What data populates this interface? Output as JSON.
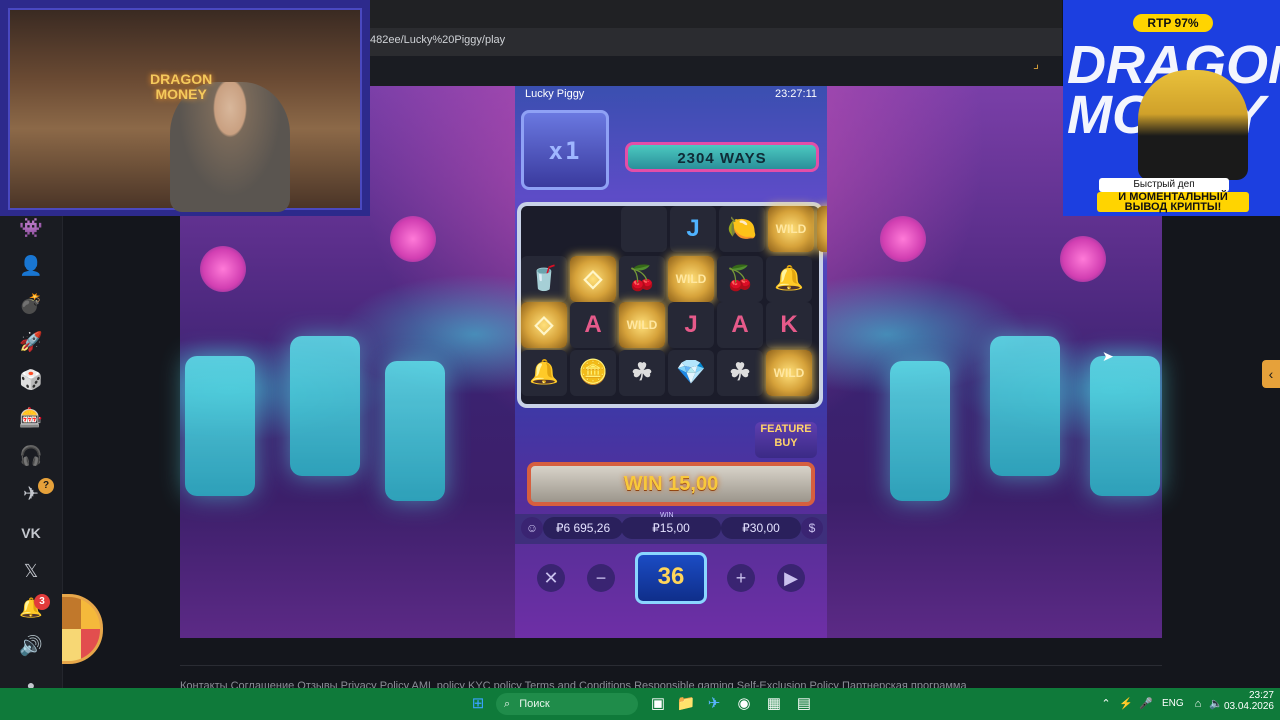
{
  "browser": {
    "url": "482ee/Lucky%20Piggy/play"
  },
  "webcam": {
    "brand_line1": "DRAGON",
    "brand_line2": "MONEY"
  },
  "ad": {
    "rtp": "RTP 97%",
    "brand": "DRAGON MONEY",
    "line1": "Быстрый деп",
    "line2_a": "И МОМЕНТАЛЬНЫЙ",
    "line2_b": "ВЫВОД КРИПТЫ!"
  },
  "game": {
    "name": "Lucky Piggy",
    "time": "23:27:11",
    "multiplier": "x1",
    "ways": "2304 WAYS",
    "feature_buy_1": "FEATURE",
    "feature_buy_2": "BUY",
    "win_text": "WIN 15,00",
    "balance": "₽6 695,26",
    "win_label": "WIN",
    "win_amount": "₽15,00",
    "bet": "₽30,00",
    "spins": "36",
    "reels": [
      [
        "",
        "J",
        "🍋",
        "WILD",
        "◇"
      ],
      [
        "🥤",
        "◇",
        "🍒",
        "WILD",
        "🍒",
        "🔔"
      ],
      [
        "◇",
        "A",
        "WILD",
        "J",
        "A",
        "K"
      ],
      [
        "🔔",
        "🪙",
        "☘",
        "💎",
        "☘",
        "WILD"
      ]
    ]
  },
  "sidebar": {
    "notifications_badge": "3",
    "telegram_badge": "?"
  },
  "footer": {
    "links": "Контакты   Соглашение   Отзывы   Privacy Policy   AML policy   KYC policy   Terms and Conditions   Responsible gaming   Self-Exclusion Policy   Партнерская программа"
  },
  "taskbar": {
    "search_placeholder": "Поиск",
    "lang": "ENG",
    "time": "23:27",
    "date": "03.04.2026"
  }
}
